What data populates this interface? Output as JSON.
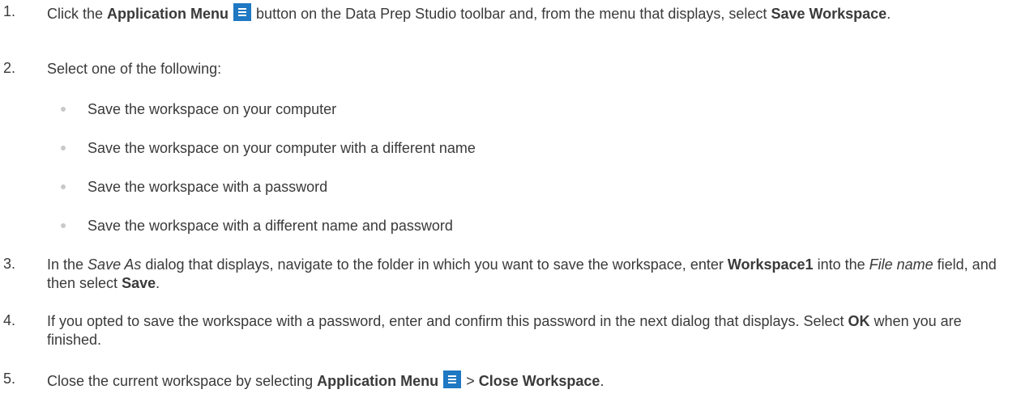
{
  "steps": [
    {
      "number": "1.",
      "parts": {
        "a": "Click the ",
        "b": "Application Menu",
        "c": " button on the Data Prep Studio toolbar and, from the menu that displays, select ",
        "d": "Save Workspace",
        "e": "."
      }
    },
    {
      "number": "2.",
      "parts": {
        "a": "Select one of the following:"
      }
    },
    {
      "number": "3.",
      "parts": {
        "a": "In the ",
        "b": "Save As",
        "c": " dialog that displays, navigate to the folder in which you want to save the workspace, enter ",
        "d": "Workspace1",
        "e": " into the ",
        "f": "File name",
        "g": " field, and then select ",
        "h": "Save",
        "i": "."
      }
    },
    {
      "number": "4.",
      "parts": {
        "a": "If you opted to save the workspace with a password, enter and confirm this password in the next dialog that displays. Select ",
        "b": "OK",
        "c": " when you are finished."
      }
    },
    {
      "number": "5.",
      "parts": {
        "a": "Close the current workspace by selecting ",
        "b": "Application Menu",
        "c": " > ",
        "d": "Close Workspace",
        "e": "."
      }
    }
  ],
  "options": [
    "Save the workspace on your computer",
    "Save the workspace on your computer with a different name",
    "Save the workspace with a password",
    "Save the workspace with a different name and password"
  ],
  "icons": {
    "application_menu": "hamburger-menu-icon",
    "application_menu_color": "#1e78c2"
  }
}
